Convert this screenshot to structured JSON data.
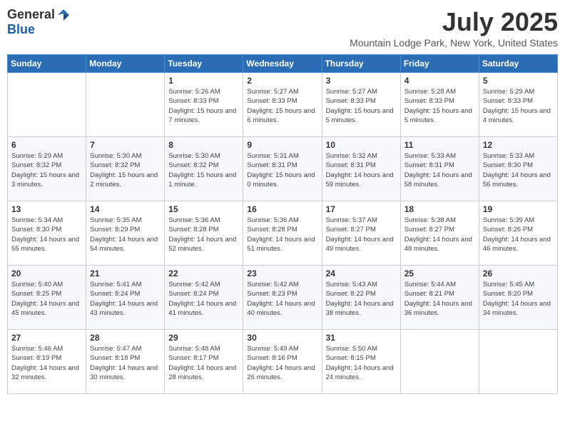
{
  "logo": {
    "general": "General",
    "blue": "Blue"
  },
  "title": "July 2025",
  "subtitle": "Mountain Lodge Park, New York, United States",
  "days_of_week": [
    "Sunday",
    "Monday",
    "Tuesday",
    "Wednesday",
    "Thursday",
    "Friday",
    "Saturday"
  ],
  "weeks": [
    [
      {
        "day": "",
        "info": ""
      },
      {
        "day": "",
        "info": ""
      },
      {
        "day": "1",
        "info": "Sunrise: 5:26 AM\nSunset: 8:33 PM\nDaylight: 15 hours and 7 minutes."
      },
      {
        "day": "2",
        "info": "Sunrise: 5:27 AM\nSunset: 8:33 PM\nDaylight: 15 hours and 6 minutes."
      },
      {
        "day": "3",
        "info": "Sunrise: 5:27 AM\nSunset: 8:33 PM\nDaylight: 15 hours and 5 minutes."
      },
      {
        "day": "4",
        "info": "Sunrise: 5:28 AM\nSunset: 8:33 PM\nDaylight: 15 hours and 5 minutes."
      },
      {
        "day": "5",
        "info": "Sunrise: 5:29 AM\nSunset: 8:33 PM\nDaylight: 15 hours and 4 minutes."
      }
    ],
    [
      {
        "day": "6",
        "info": "Sunrise: 5:29 AM\nSunset: 8:32 PM\nDaylight: 15 hours and 3 minutes."
      },
      {
        "day": "7",
        "info": "Sunrise: 5:30 AM\nSunset: 8:32 PM\nDaylight: 15 hours and 2 minutes."
      },
      {
        "day": "8",
        "info": "Sunrise: 5:30 AM\nSunset: 8:32 PM\nDaylight: 15 hours and 1 minute."
      },
      {
        "day": "9",
        "info": "Sunrise: 5:31 AM\nSunset: 8:31 PM\nDaylight: 15 hours and 0 minutes."
      },
      {
        "day": "10",
        "info": "Sunrise: 5:32 AM\nSunset: 8:31 PM\nDaylight: 14 hours and 59 minutes."
      },
      {
        "day": "11",
        "info": "Sunrise: 5:33 AM\nSunset: 8:31 PM\nDaylight: 14 hours and 58 minutes."
      },
      {
        "day": "12",
        "info": "Sunrise: 5:33 AM\nSunset: 8:30 PM\nDaylight: 14 hours and 56 minutes."
      }
    ],
    [
      {
        "day": "13",
        "info": "Sunrise: 5:34 AM\nSunset: 8:30 PM\nDaylight: 14 hours and 55 minutes."
      },
      {
        "day": "14",
        "info": "Sunrise: 5:35 AM\nSunset: 8:29 PM\nDaylight: 14 hours and 54 minutes."
      },
      {
        "day": "15",
        "info": "Sunrise: 5:36 AM\nSunset: 8:28 PM\nDaylight: 14 hours and 52 minutes."
      },
      {
        "day": "16",
        "info": "Sunrise: 5:36 AM\nSunset: 8:28 PM\nDaylight: 14 hours and 51 minutes."
      },
      {
        "day": "17",
        "info": "Sunrise: 5:37 AM\nSunset: 8:27 PM\nDaylight: 14 hours and 49 minutes."
      },
      {
        "day": "18",
        "info": "Sunrise: 5:38 AM\nSunset: 8:27 PM\nDaylight: 14 hours and 48 minutes."
      },
      {
        "day": "19",
        "info": "Sunrise: 5:39 AM\nSunset: 8:26 PM\nDaylight: 14 hours and 46 minutes."
      }
    ],
    [
      {
        "day": "20",
        "info": "Sunrise: 5:40 AM\nSunset: 8:25 PM\nDaylight: 14 hours and 45 minutes."
      },
      {
        "day": "21",
        "info": "Sunrise: 5:41 AM\nSunset: 8:24 PM\nDaylight: 14 hours and 43 minutes."
      },
      {
        "day": "22",
        "info": "Sunrise: 5:42 AM\nSunset: 8:24 PM\nDaylight: 14 hours and 41 minutes."
      },
      {
        "day": "23",
        "info": "Sunrise: 5:42 AM\nSunset: 8:23 PM\nDaylight: 14 hours and 40 minutes."
      },
      {
        "day": "24",
        "info": "Sunrise: 5:43 AM\nSunset: 8:22 PM\nDaylight: 14 hours and 38 minutes."
      },
      {
        "day": "25",
        "info": "Sunrise: 5:44 AM\nSunset: 8:21 PM\nDaylight: 14 hours and 36 minutes."
      },
      {
        "day": "26",
        "info": "Sunrise: 5:45 AM\nSunset: 8:20 PM\nDaylight: 14 hours and 34 minutes."
      }
    ],
    [
      {
        "day": "27",
        "info": "Sunrise: 5:46 AM\nSunset: 8:19 PM\nDaylight: 14 hours and 32 minutes."
      },
      {
        "day": "28",
        "info": "Sunrise: 5:47 AM\nSunset: 8:18 PM\nDaylight: 14 hours and 30 minutes."
      },
      {
        "day": "29",
        "info": "Sunrise: 5:48 AM\nSunset: 8:17 PM\nDaylight: 14 hours and 28 minutes."
      },
      {
        "day": "30",
        "info": "Sunrise: 5:49 AM\nSunset: 8:16 PM\nDaylight: 14 hours and 26 minutes."
      },
      {
        "day": "31",
        "info": "Sunrise: 5:50 AM\nSunset: 8:15 PM\nDaylight: 14 hours and 24 minutes."
      },
      {
        "day": "",
        "info": ""
      },
      {
        "day": "",
        "info": ""
      }
    ]
  ]
}
